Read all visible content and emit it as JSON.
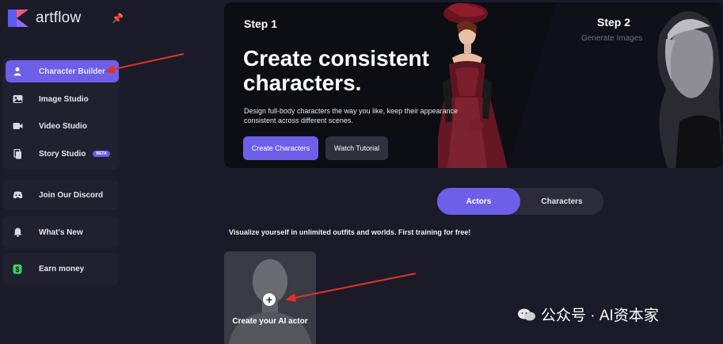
{
  "app": {
    "name": "artflow"
  },
  "sidebar": {
    "items": [
      {
        "label": "Character Builder",
        "icon": "user-icon"
      },
      {
        "label": "Image Studio",
        "icon": "image-icon"
      },
      {
        "label": "Video Studio",
        "icon": "video-icon"
      },
      {
        "label": "Story Studio",
        "icon": "book-icon",
        "badge": "BETA"
      },
      {
        "label": "Join Our Discord",
        "icon": "discord-icon"
      },
      {
        "label": "What's New",
        "icon": "bell-icon"
      },
      {
        "label": "Earn money",
        "icon": "dollar-icon"
      }
    ]
  },
  "hero": {
    "step1": "Step 1",
    "title": "Create consistent characters.",
    "description": "Design full-body characters the way you like, keep their appearance consistent across different scenes.",
    "primary_button": "Create Characters",
    "secondary_button": "Watch Tutorial",
    "step2": "Step 2",
    "step2_sub": "Generate Images"
  },
  "tabs": {
    "actors": "Actors",
    "characters": "Characters"
  },
  "subtitle": "Visualize yourself in unlimited outfits and worlds. First training for free!",
  "card": {
    "label": "Create your AI actor"
  },
  "watermark": "公众号 · AI资本家",
  "colors": {
    "accent": "#6d5fe8",
    "background": "#1a1a28",
    "sidebar": "#1b1b29",
    "arrow": "#e0302a"
  }
}
